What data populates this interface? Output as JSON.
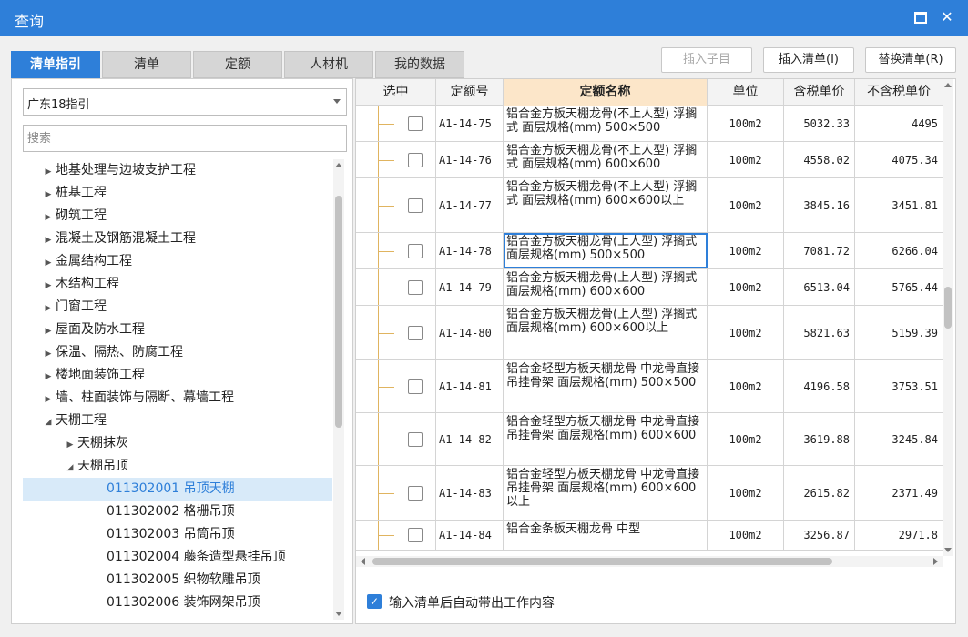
{
  "window": {
    "title": "查询"
  },
  "tabs": [
    "清单指引",
    "清单",
    "定额",
    "人材机",
    "我的数据"
  ],
  "toolbar": {
    "insert_child": "插入子目",
    "insert_list": "插入清单(I)",
    "replace_list": "替换清单(R)"
  },
  "left": {
    "selected_guide": "广东18指引",
    "search_placeholder": "搜索",
    "tree": [
      {
        "label": "地基处理与边坡支护工程",
        "level": 0,
        "arrow": "▶"
      },
      {
        "label": "桩基工程",
        "level": 0,
        "arrow": "▶"
      },
      {
        "label": "砌筑工程",
        "level": 0,
        "arrow": "▶"
      },
      {
        "label": "混凝土及钢筋混凝土工程",
        "level": 0,
        "arrow": "▶"
      },
      {
        "label": "金属结构工程",
        "level": 0,
        "arrow": "▶"
      },
      {
        "label": "木结构工程",
        "level": 0,
        "arrow": "▶"
      },
      {
        "label": "门窗工程",
        "level": 0,
        "arrow": "▶"
      },
      {
        "label": "屋面及防水工程",
        "level": 0,
        "arrow": "▶"
      },
      {
        "label": "保温、隔热、防腐工程",
        "level": 0,
        "arrow": "▶"
      },
      {
        "label": "楼地面装饰工程",
        "level": 0,
        "arrow": "▶"
      },
      {
        "label": "墙、柱面装饰与隔断、幕墙工程",
        "level": 0,
        "arrow": "▶"
      },
      {
        "label": "天棚工程",
        "level": 0,
        "arrow": "◢"
      },
      {
        "label": "天棚抹灰",
        "level": 1,
        "arrow": "▶"
      },
      {
        "label": "天棚吊顶",
        "level": 1,
        "arrow": "◢"
      },
      {
        "label": "011302001  吊顶天棚",
        "level": 2,
        "arrow": ""
      },
      {
        "label": "011302002  格栅吊顶",
        "level": 2,
        "arrow": ""
      },
      {
        "label": "011302003  吊筒吊顶",
        "level": 2,
        "arrow": ""
      },
      {
        "label": "011302004  藤条造型悬挂吊顶",
        "level": 2,
        "arrow": ""
      },
      {
        "label": "011302005  织物软雕吊顶",
        "level": 2,
        "arrow": ""
      },
      {
        "label": "011302006  装饰网架吊顶",
        "level": 2,
        "arrow": ""
      }
    ]
  },
  "grid": {
    "columns": [
      "选中",
      "定额号",
      "定额名称",
      "单位",
      "含税单价",
      "不含税单价"
    ],
    "rows": [
      {
        "code": "A1-14-75",
        "name": "铝合金方板天棚龙骨(不上人型) 浮搁式 面层规格(mm) 500×500",
        "unit": "100m2",
        "tax": "5032.33",
        "notax": "4495"
      },
      {
        "code": "A1-14-76",
        "name": "铝合金方板天棚龙骨(不上人型) 浮搁式 面层规格(mm) 600×600",
        "unit": "100m2",
        "tax": "4558.02",
        "notax": "4075.34"
      },
      {
        "code": "A1-14-77",
        "name": "铝合金方板天棚龙骨(不上人型) 浮搁式 面层规格(mm) 600×600以上",
        "unit": "100m2",
        "tax": "3845.16",
        "notax": "3451.81"
      },
      {
        "code": "A1-14-78",
        "name": "铝合金方板天棚龙骨(上人型) 浮搁式 面层规格(mm) 500×500",
        "unit": "100m2",
        "tax": "7081.72",
        "notax": "6266.04"
      },
      {
        "code": "A1-14-79",
        "name": "铝合金方板天棚龙骨(上人型) 浮搁式 面层规格(mm) 600×600",
        "unit": "100m2",
        "tax": "6513.04",
        "notax": "5765.44"
      },
      {
        "code": "A1-14-80",
        "name": "铝合金方板天棚龙骨(上人型) 浮搁式 面层规格(mm) 600×600以上",
        "unit": "100m2",
        "tax": "5821.63",
        "notax": "5159.39"
      },
      {
        "code": "A1-14-81",
        "name": "铝合金轻型方板天棚龙骨 中龙骨直接吊挂骨架 面层规格(mm) 500×500",
        "unit": "100m2",
        "tax": "4196.58",
        "notax": "3753.51"
      },
      {
        "code": "A1-14-82",
        "name": "铝合金轻型方板天棚龙骨 中龙骨直接吊挂骨架 面层规格(mm) 600×600",
        "unit": "100m2",
        "tax": "3619.88",
        "notax": "3245.84"
      },
      {
        "code": "A1-14-83",
        "name": "铝合金轻型方板天棚龙骨 中龙骨直接吊挂骨架 面层规格(mm) 600×600以上",
        "unit": "100m2",
        "tax": "2615.82",
        "notax": "2371.49"
      },
      {
        "code": "A1-14-84",
        "name": "铝合金条板天棚龙骨 中型",
        "unit": "100m2",
        "tax": "3256.87",
        "notax": "2971.8"
      }
    ]
  },
  "auto_fill_label": "输入清单后自动带出工作内容"
}
